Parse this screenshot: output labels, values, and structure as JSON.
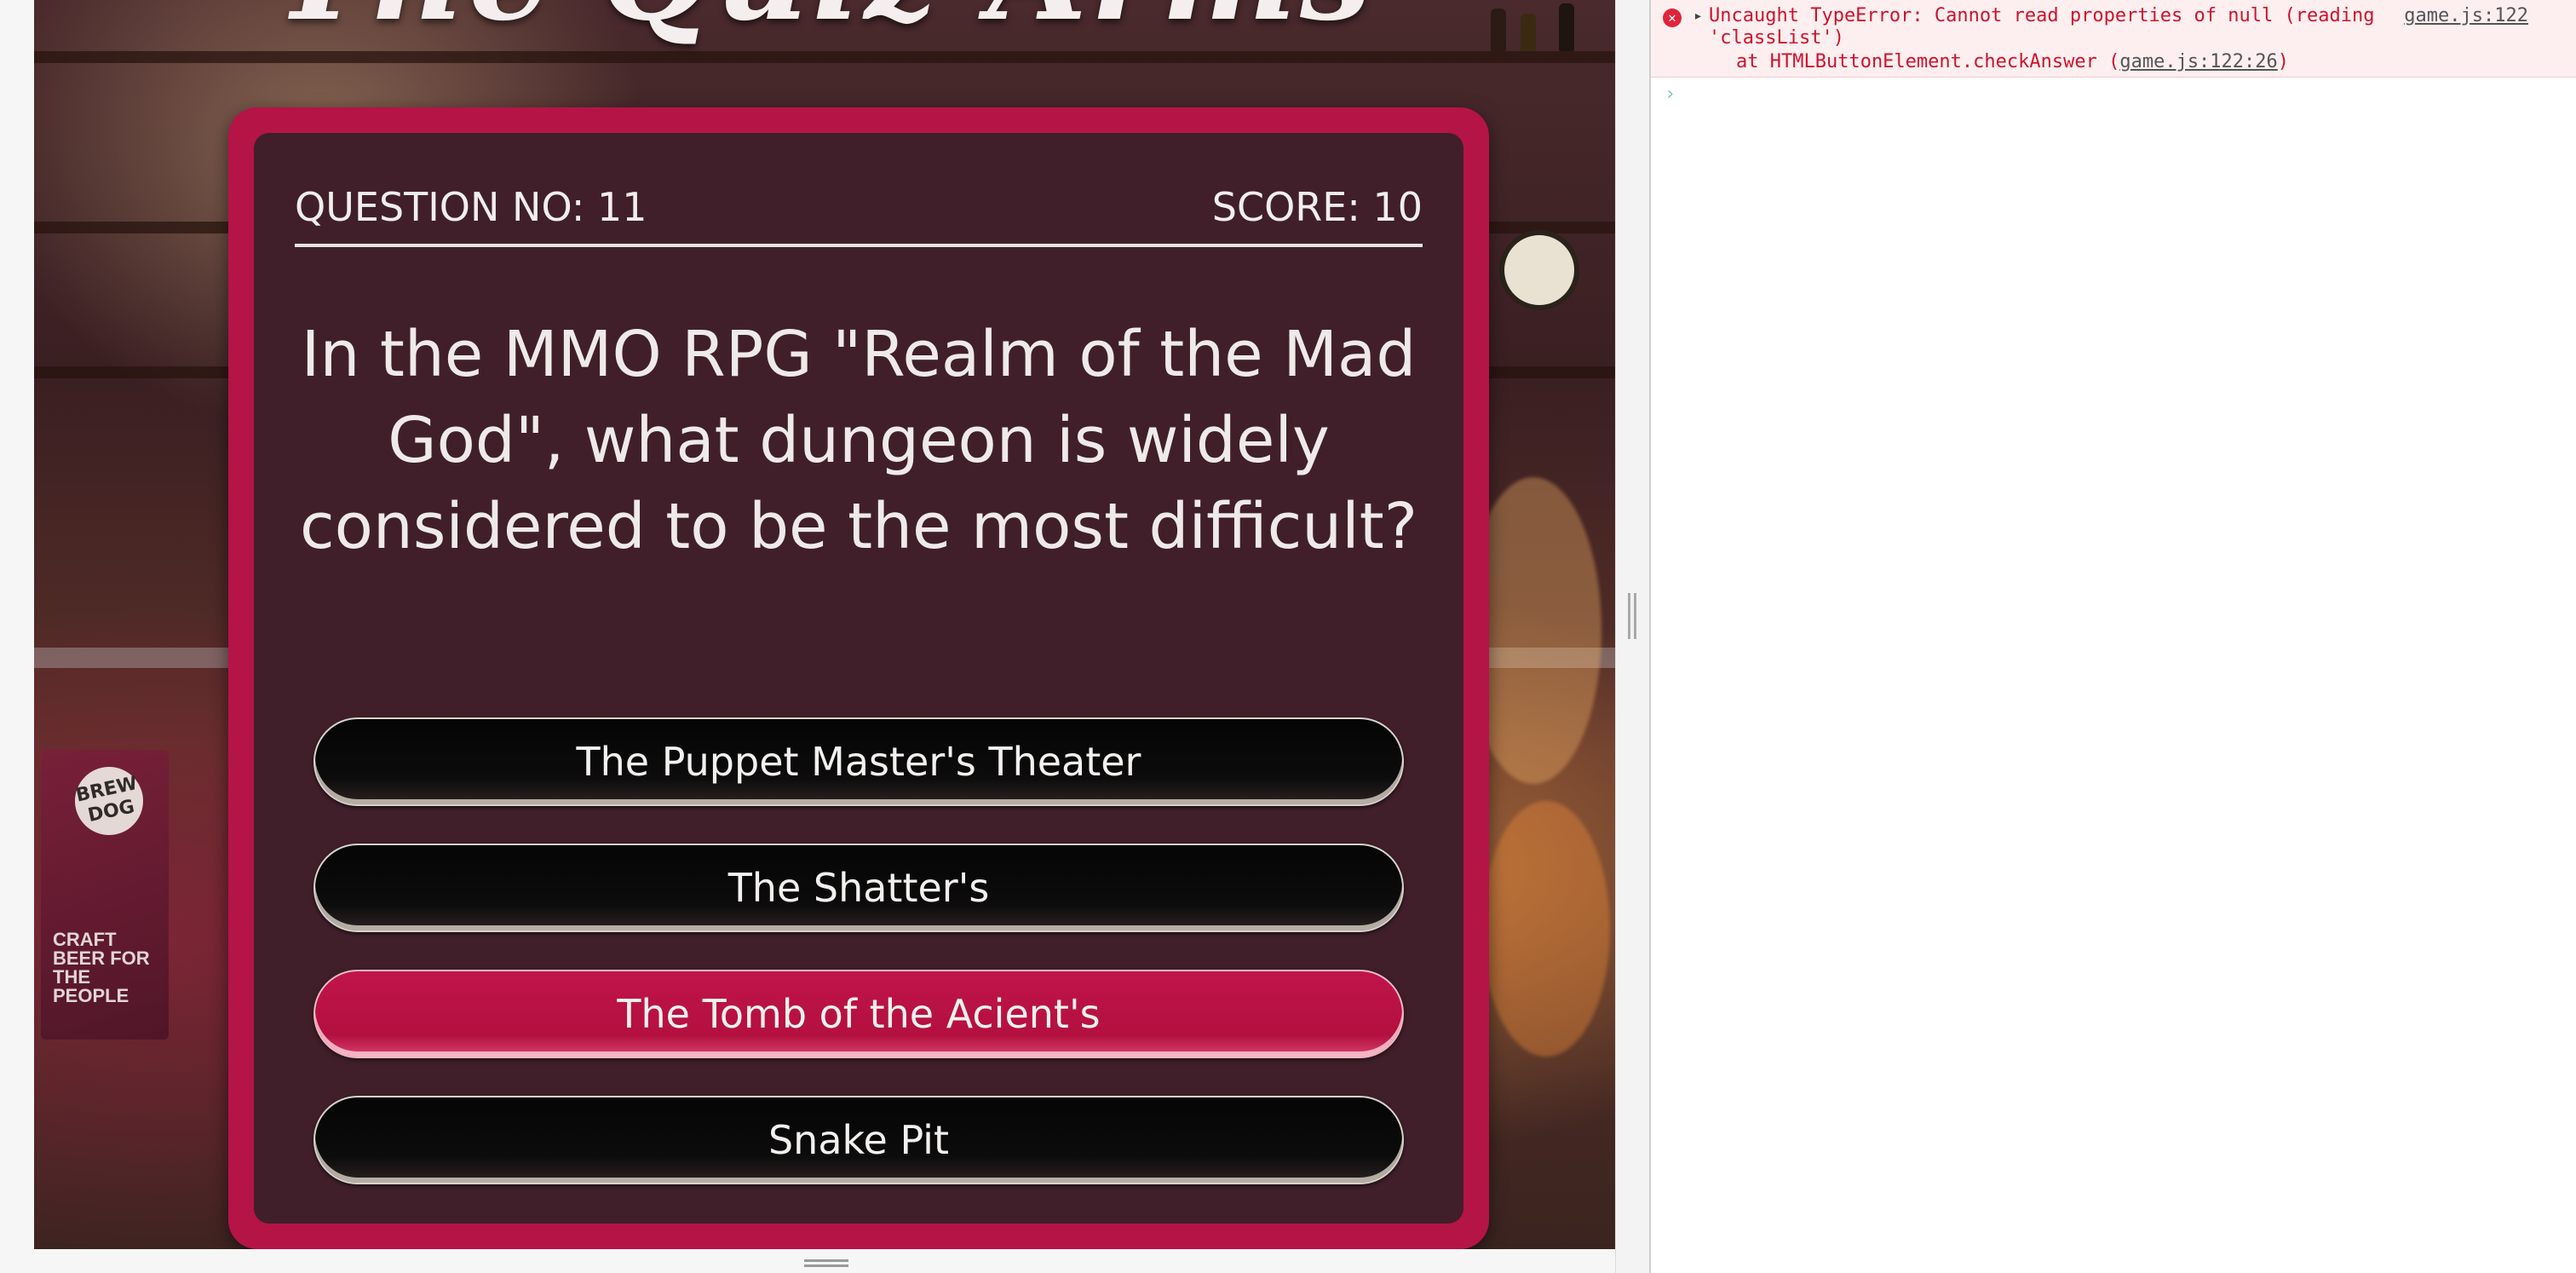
{
  "page": {
    "title_text": "The Quiz Arms",
    "background_signs": {
      "brewdog": "BREW DOG",
      "craft_beer": "CRAFT BEER FOR THE PEOPLE"
    }
  },
  "quiz": {
    "question_no": "QUESTION NO: 11",
    "score": "SCORE: 10",
    "question": "In the MMO RPG \"Realm of the Mad God\", what dungeon is widely considered to be the most difficult?",
    "answers": [
      {
        "label": "The Puppet Master's Theater",
        "selected": false
      },
      {
        "label": "The Shatter's",
        "selected": false
      },
      {
        "label": "The Tomb of the Acient's",
        "selected": true
      },
      {
        "label": "Snake Pit",
        "selected": false
      }
    ],
    "colors": {
      "frame": "#b51446",
      "selected_answer": "#c0144b",
      "answer_default": "#050505"
    }
  },
  "devtools": {
    "console": {
      "error": {
        "message_line1": "Uncaught TypeError: Cannot read properties of null (reading",
        "message_line2": "'classList')",
        "stack_prefix": "at HTMLButtonElement.checkAnswer (",
        "stack_location": "game.js:122:26",
        "stack_suffix": ")",
        "source": "game.js:122",
        "icon": "error-icon",
        "color": "#d1112a"
      },
      "prompt": "›"
    }
  }
}
